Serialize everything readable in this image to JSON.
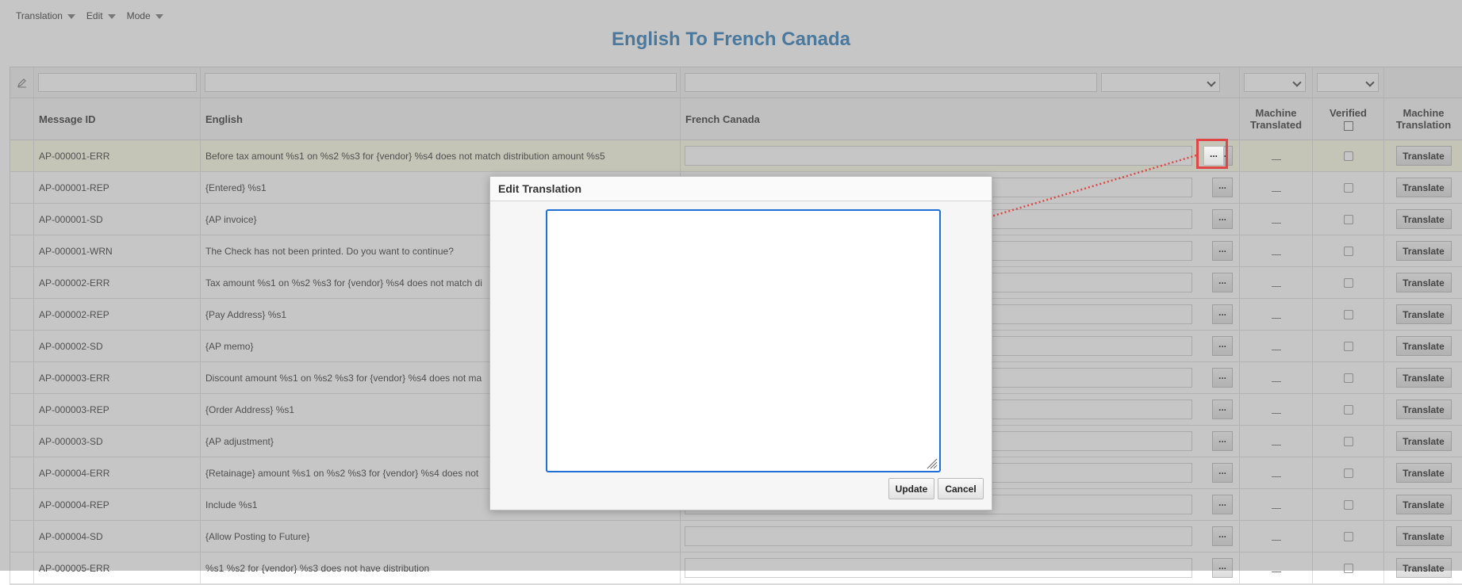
{
  "menus": [
    "Translation",
    "Edit",
    "Mode"
  ],
  "page_title": "English To French Canada",
  "columns": {
    "message_id": "Message ID",
    "english": "English",
    "french": "French Canada",
    "machine_translated": "Machine Translated",
    "verified": "Verified",
    "machine_translation": "Machine Translation"
  },
  "row_button_label": "...",
  "translate_label": "Translate",
  "machine_translated_value": "__",
  "rows": [
    {
      "id": "AP-000001-ERR",
      "english": "Before tax amount %s1 on %s2 %s3 for {vendor} %s4 does not match distribution amount %s5"
    },
    {
      "id": "AP-000001-REP",
      "english": "{Entered} %s1"
    },
    {
      "id": "AP-000001-SD",
      "english": "{AP invoice}"
    },
    {
      "id": "AP-000001-WRN",
      "english": "The Check has not been printed. Do you want to continue?"
    },
    {
      "id": "AP-000002-ERR",
      "english": "Tax amount %s1 on %s2 %s3 for {vendor} %s4 does not match di"
    },
    {
      "id": "AP-000002-REP",
      "english": "{Pay Address} %s1"
    },
    {
      "id": "AP-000002-SD",
      "english": "{AP memo}"
    },
    {
      "id": "AP-000003-ERR",
      "english": "Discount amount %s1 on %s2 %s3 for {vendor} %s4 does not ma"
    },
    {
      "id": "AP-000003-REP",
      "english": "{Order Address} %s1"
    },
    {
      "id": "AP-000003-SD",
      "english": "{AP adjustment}"
    },
    {
      "id": "AP-000004-ERR",
      "english": "{Retainage} amount %s1 on %s2 %s3 for {vendor} %s4 does not"
    },
    {
      "id": "AP-000004-REP",
      "english": "Include %s1"
    },
    {
      "id": "AP-000004-SD",
      "english": "{Allow Posting to Future}"
    },
    {
      "id": "AP-000005-ERR",
      "english": "%s1 %s2 for {vendor} %s3 does not have distribution"
    }
  ],
  "dialog": {
    "title": "Edit Translation",
    "text_value": "",
    "update_label": "Update",
    "cancel_label": "Cancel"
  },
  "colors": {
    "title": "#2b7ab8",
    "highlight": "#e04646",
    "dialog_focus": "#1f6fd6"
  }
}
